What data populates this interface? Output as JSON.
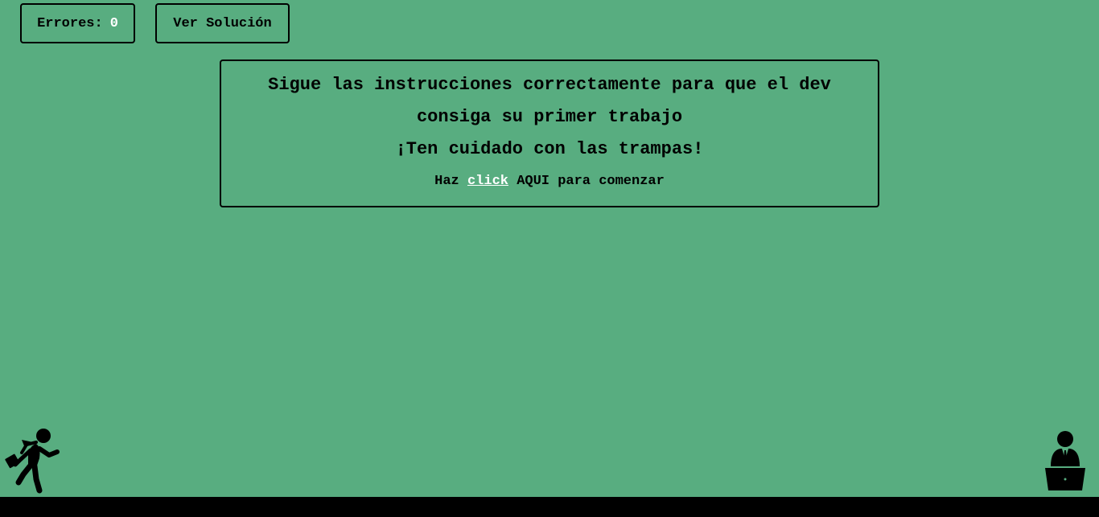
{
  "header": {
    "errors_label": "Errores:",
    "errors_count": "0",
    "solution_label": "Ver Solución"
  },
  "panel": {
    "instruction": "Sigue las instrucciones correctamente para que el dev consiga su primer trabajo",
    "warning": "¡Ten cuidado con las trampas!",
    "start_prefix": "Haz",
    "start_link": "click",
    "start_suffix": "AQUI para comenzar"
  },
  "icons": {
    "runner": "running-developer-icon",
    "recruiter": "recruiter-at-laptop-icon"
  },
  "colors": {
    "background": "#58ad80",
    "ground": "#000000",
    "highlight": "#ffffff"
  }
}
